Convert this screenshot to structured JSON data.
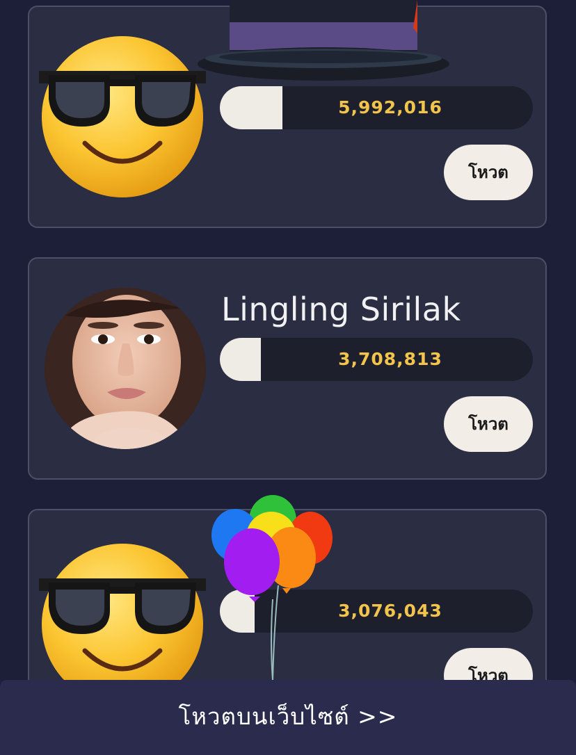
{
  "entries": [
    {
      "name": "",
      "votes": "5,992,016",
      "vote_label": "โหวต",
      "progress": 0.2,
      "avatar": "sunglasses-emoji-icon"
    },
    {
      "name": "Lingling Sirilak",
      "votes": "3,708,813",
      "vote_label": "โหวต",
      "progress": 0.13,
      "avatar": "profile-photo"
    },
    {
      "name": "",
      "votes": "3,076,043",
      "vote_label": "โหวต",
      "progress": 0.11,
      "avatar": "sunglasses-emoji-icon"
    }
  ],
  "bottom": {
    "link_label": "โหวตบนเว็บไซต์ >>"
  },
  "stickers": [
    "top-hat-icon",
    "balloons-icon"
  ],
  "colors": {
    "background": "#1d1f39",
    "card": "#2b2e43",
    "card_border": "#4c4f66",
    "value_text": "#f2c44b",
    "button": "#f2eee7",
    "bottom_bar": "#2b2b4e"
  }
}
